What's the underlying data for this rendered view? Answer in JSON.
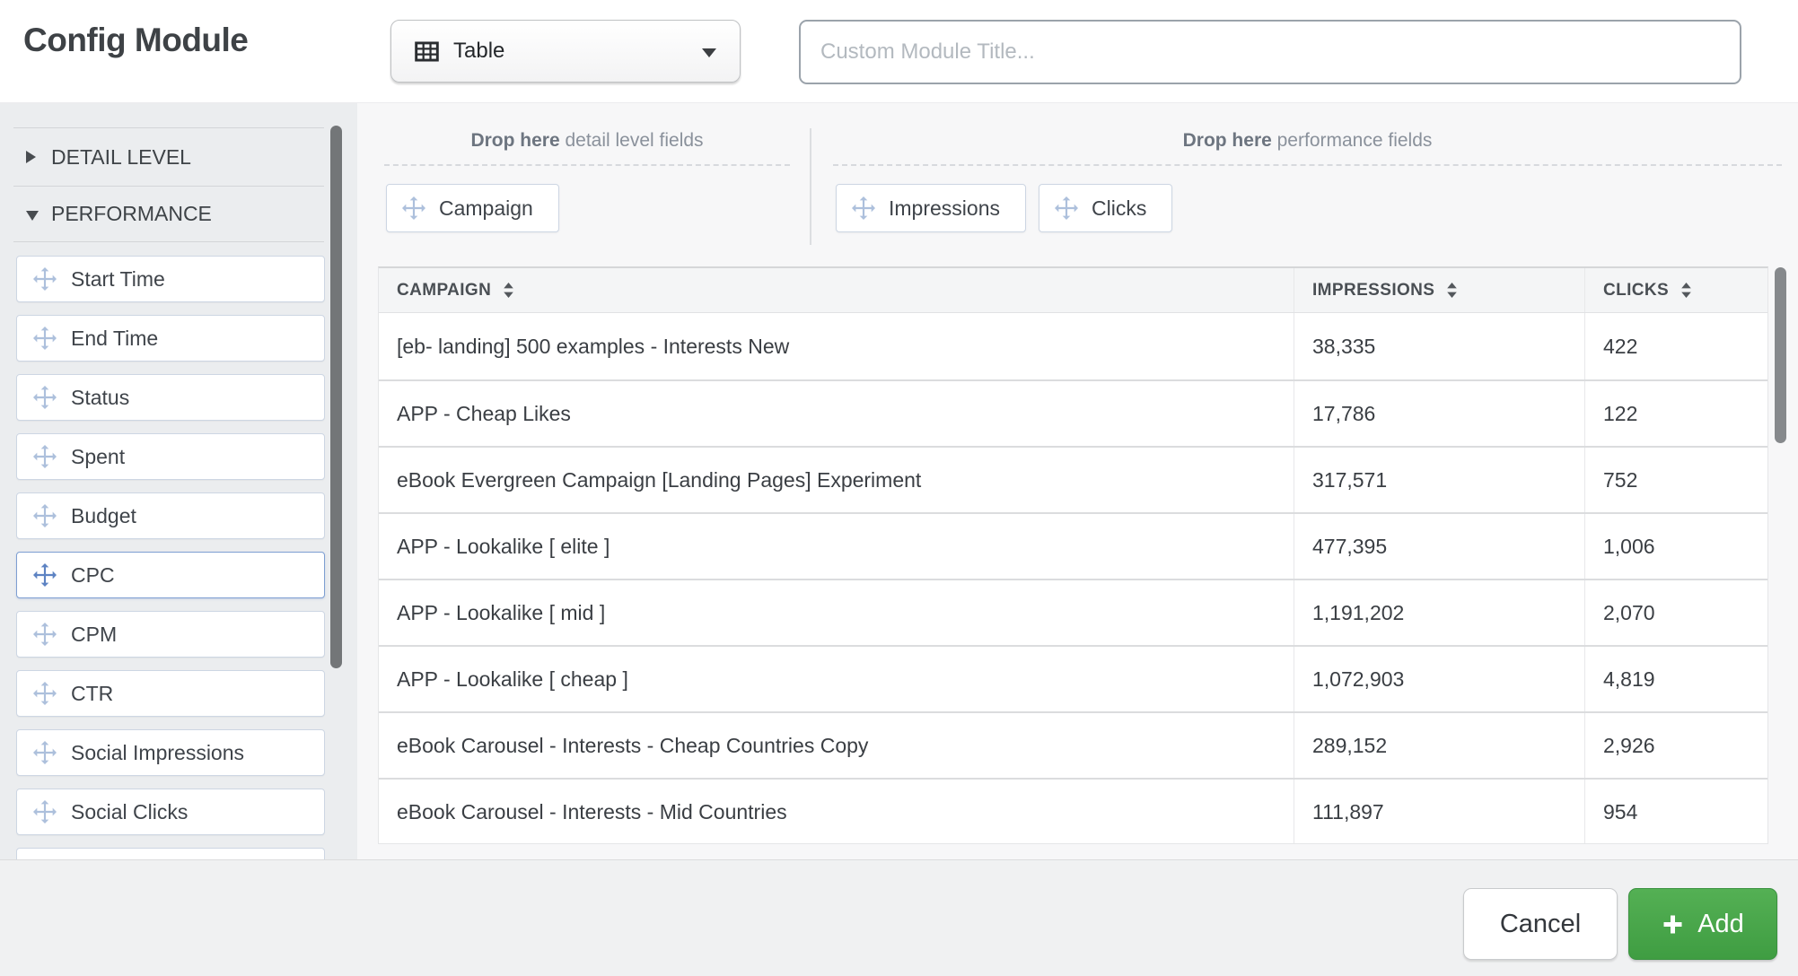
{
  "header": {
    "title": "Config Module",
    "type_selector": {
      "label": "Table",
      "icon": "table-grid-icon",
      "chevron": "chevron-down-icon"
    },
    "custom_title": {
      "value": "",
      "placeholder": "Custom Module Title..."
    }
  },
  "sidebar": {
    "sections": [
      {
        "label": "DETAIL LEVEL",
        "state": "collapsed"
      },
      {
        "label": "PERFORMANCE",
        "state": "expanded"
      }
    ],
    "fields": [
      "Start Time",
      "End Time",
      "Status",
      "Spent",
      "Budget",
      "CPC",
      "CPM",
      "CTR",
      "Social Impressions",
      "Social Clicks"
    ],
    "active_field": "CPC",
    "drag_icon": "move-icon"
  },
  "dropzones": {
    "detail": {
      "label_bold": "Drop here",
      "label_rest": " detail level fields",
      "chips": [
        "Campaign"
      ]
    },
    "performance": {
      "label_bold": "Drop here",
      "label_rest": " performance fields",
      "chips": [
        "Impressions",
        "Clicks"
      ]
    }
  },
  "table": {
    "columns": [
      "CAMPAIGN",
      "IMPRESSIONS",
      "CLICKS"
    ],
    "sort_icon": "sort-icon",
    "rows": [
      {
        "campaign": "[eb- landing] 500 examples - Interests New",
        "impressions": "38,335",
        "clicks": "422"
      },
      {
        "campaign": "APP - Cheap Likes",
        "impressions": "17,786",
        "clicks": "122"
      },
      {
        "campaign": "eBook Evergreen Campaign [Landing Pages] Experiment",
        "impressions": "317,571",
        "clicks": "752"
      },
      {
        "campaign": "APP - Lookalike [ elite ]",
        "impressions": "477,395",
        "clicks": "1,006"
      },
      {
        "campaign": "APP - Lookalike [ mid ]",
        "impressions": "1,191,202",
        "clicks": "2,070"
      },
      {
        "campaign": "APP - Lookalike [ cheap ]",
        "impressions": "1,072,903",
        "clicks": "4,819"
      },
      {
        "campaign": "eBook Carousel - Interests - Cheap Countries Copy",
        "impressions": "289,152",
        "clicks": "2,926"
      },
      {
        "campaign": "eBook Carousel - Interests - Mid Countries",
        "impressions": "111,897",
        "clicks": "954"
      }
    ]
  },
  "footer": {
    "cancel_label": "Cancel",
    "add_label": "Add",
    "add_icon": "plus-icon"
  },
  "colors": {
    "accent_green": "#47A449",
    "sidebar_bg": "#EBEDEF",
    "main_bg": "#F7F7F8",
    "footer_bg": "#F0F1F2",
    "field_border": "#CDD6E3",
    "active_field_border": "#7E9FD2",
    "move_icon": "#ADC0DC",
    "move_icon_active": "#5D83C3"
  }
}
